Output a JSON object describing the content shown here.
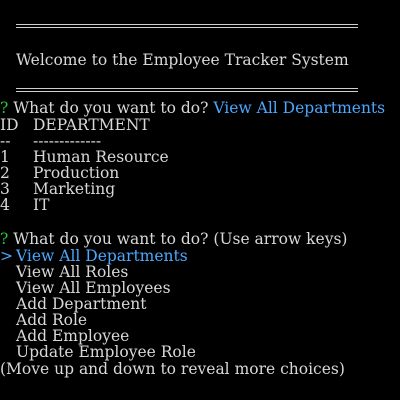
{
  "banner": {
    "welcome": "Welcome to the Employee Tracker System"
  },
  "prompt1": {
    "mark": "?",
    "question": "What do you want to do?",
    "answer": "View All Departments"
  },
  "table": {
    "headers": [
      "ID",
      "DEPARTMENT"
    ],
    "sep_id": "--",
    "sep_dept": "-------------",
    "rows": [
      {
        "id": "1",
        "name": "Human Resource"
      },
      {
        "id": "2",
        "name": "Production"
      },
      {
        "id": "3",
        "name": "Marketing"
      },
      {
        "id": "4",
        "name": "IT"
      }
    ]
  },
  "prompt2": {
    "mark": "?",
    "question": "What do you want to do?",
    "hint": "(Use arrow keys)",
    "pointer": ">",
    "choices": [
      "View All Departments",
      "View All Roles",
      "View All Employees",
      "Add Department",
      "Add Role",
      "Add Employee",
      "Update Employee Role"
    ],
    "footer": "(Move up and down to reveal more choices)"
  },
  "colors": {
    "background": "#000000",
    "text": "#d8d8d8",
    "prompt_mark": "#27c93f",
    "highlight": "#4aa8ff"
  }
}
